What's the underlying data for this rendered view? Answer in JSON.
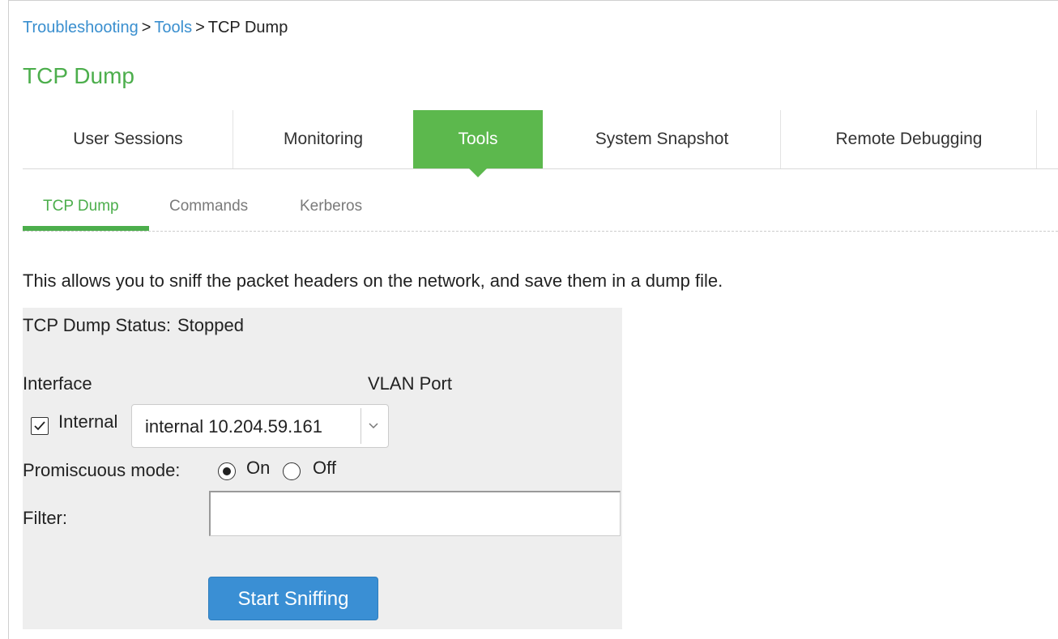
{
  "breadcrumb": {
    "items": [
      {
        "label": "Troubleshooting"
      },
      {
        "label": "Tools"
      },
      {
        "label": "TCP Dump"
      }
    ],
    "separator": ">"
  },
  "page": {
    "title": "TCP Dump",
    "description": "This allows you to sniff the packet headers on the network, and save them in a dump file."
  },
  "main_tabs": [
    {
      "label": "User Sessions",
      "active": false
    },
    {
      "label": "Monitoring",
      "active": false
    },
    {
      "label": "Tools",
      "active": true
    },
    {
      "label": "System Snapshot",
      "active": false
    },
    {
      "label": "Remote Debugging",
      "active": false
    }
  ],
  "sub_tabs": [
    {
      "label": "TCP Dump",
      "active": true
    },
    {
      "label": "Commands",
      "active": false
    },
    {
      "label": "Kerberos",
      "active": false
    }
  ],
  "form": {
    "status_label": "TCP Dump Status:",
    "status_value": "Stopped",
    "interface_label": "Interface",
    "vlan_port_label": "VLAN Port",
    "internal_checkbox": {
      "label": "Internal",
      "checked": true
    },
    "interface_select": {
      "selected": "internal 10.204.59.161"
    },
    "promiscuous": {
      "label": "Promiscuous mode:",
      "options": [
        {
          "label": "On",
          "selected": true
        },
        {
          "label": "Off",
          "selected": false
        }
      ]
    },
    "filter": {
      "label": "Filter:",
      "value": "",
      "placeholder": ""
    },
    "start_button": "Start Sniffing"
  },
  "colors": {
    "accent_green": "#5cb84d",
    "link_blue": "#3a8fcf",
    "button_blue": "#3a8fd4",
    "panel_gray": "#eeeeee"
  },
  "icons": {
    "checkbox_mark": "check-icon",
    "select_arrow": "chevron-down-icon"
  }
}
